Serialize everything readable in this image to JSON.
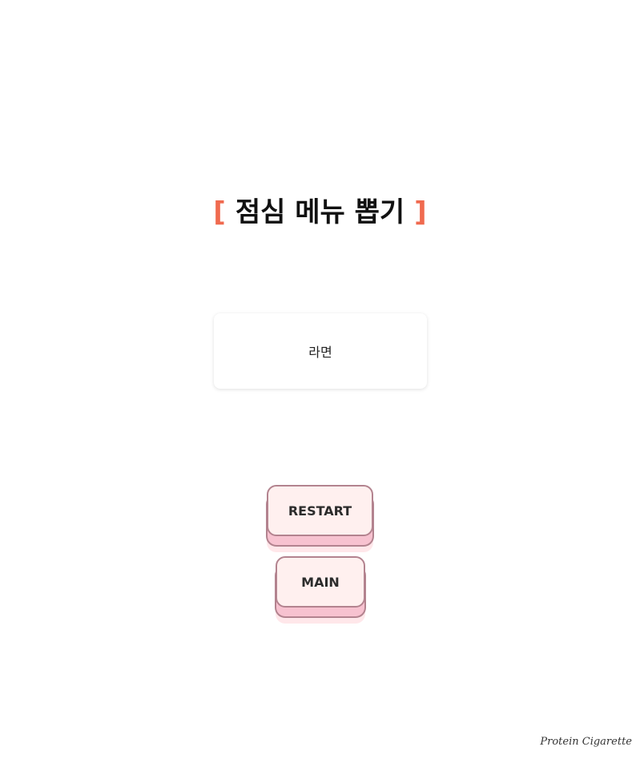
{
  "title": {
    "left_bracket": "[",
    "text": "점심 메뉴 뽑기",
    "right_bracket": "]"
  },
  "result": {
    "value": "라면"
  },
  "buttons": {
    "restart_label": "RESTART",
    "main_label": "MAIN"
  },
  "footer": {
    "signature": "Protein Cigarette"
  },
  "colors": {
    "bracket": "#f06a4f",
    "button_fill": "#fff0ef",
    "button_border": "#b3838f",
    "button_shadow": "#f7c2d0"
  }
}
